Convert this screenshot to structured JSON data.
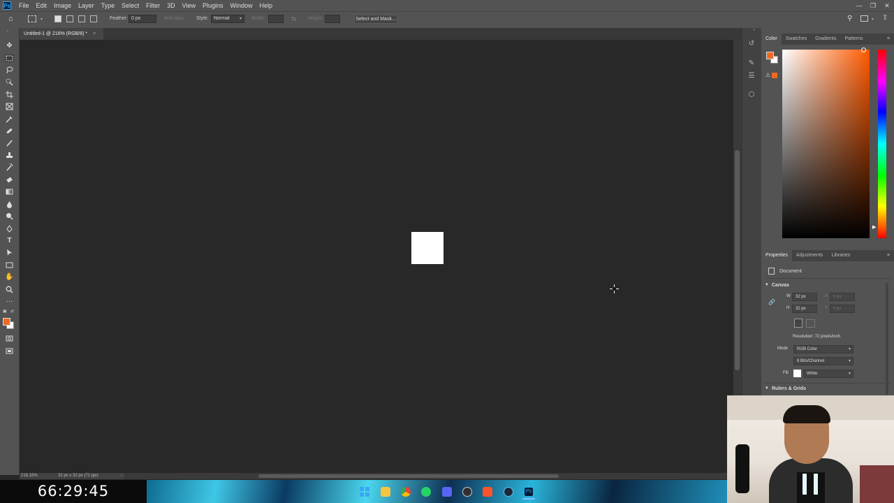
{
  "menubar": {
    "logo": "Ps",
    "items": [
      "File",
      "Edit",
      "Image",
      "Layer",
      "Type",
      "Select",
      "Filter",
      "3D",
      "View",
      "Plugins",
      "Window",
      "Help"
    ]
  },
  "options": {
    "feather_label": "Feather:",
    "feather_value": "0 px",
    "antialias_label": "Anti-alias",
    "style_label": "Style:",
    "style_value": "Normal",
    "width_label": "Width:",
    "height_label": "Height:",
    "select_mask": "Select and Mask..."
  },
  "document": {
    "tab_title": "Untitled-1 @ 216% (RGB/8) *",
    "zoom": "216.15%",
    "doc_info": "32 px x 32 px (72 ppi)"
  },
  "color_panel": {
    "tabs": [
      "Color",
      "Swatches",
      "Gradients",
      "Patterns"
    ],
    "foreground": "#ee6a24",
    "background": "#ffffff"
  },
  "properties": {
    "tabs": [
      "Properties",
      "Adjustments",
      "Libraries"
    ],
    "type_label": "Document",
    "canvas_section": "Canvas",
    "w_label": "W",
    "w_value": "32 px",
    "h_label": "H",
    "h_value": "32 px",
    "x_label": "X",
    "x_value": "0 px",
    "y_label": "Y",
    "y_value": "0 px",
    "resolution": "Resolution: 72 pixels/inch",
    "mode_label": "Mode",
    "mode_value": "RGB Color",
    "bits_value": "8 Bits/Channel",
    "fill_label": "Fill",
    "fill_value": "White",
    "rulers_section": "Rulers & Grids"
  },
  "overlay": {
    "timer": "66:29:45"
  },
  "icons": {
    "tools": [
      "move-icon",
      "marquee-icon",
      "lasso-icon",
      "quick-select-icon",
      "crop-icon",
      "frame-icon",
      "eyedropper-icon",
      "healing-icon",
      "brush-icon",
      "stamp-icon",
      "history-brush-icon",
      "eraser-icon",
      "gradient-icon",
      "blur-icon",
      "dodge-icon",
      "pen-icon",
      "type-icon",
      "path-select-icon",
      "rectangle-icon",
      "hand-icon",
      "zoom-icon",
      "more-icon"
    ],
    "taskbar": [
      "windows-start-icon",
      "file-explorer-icon",
      "chrome-icon",
      "whatsapp-icon",
      "discord-icon",
      "obs-icon",
      "brave-icon",
      "steam-icon",
      "photoshop-icon"
    ]
  }
}
